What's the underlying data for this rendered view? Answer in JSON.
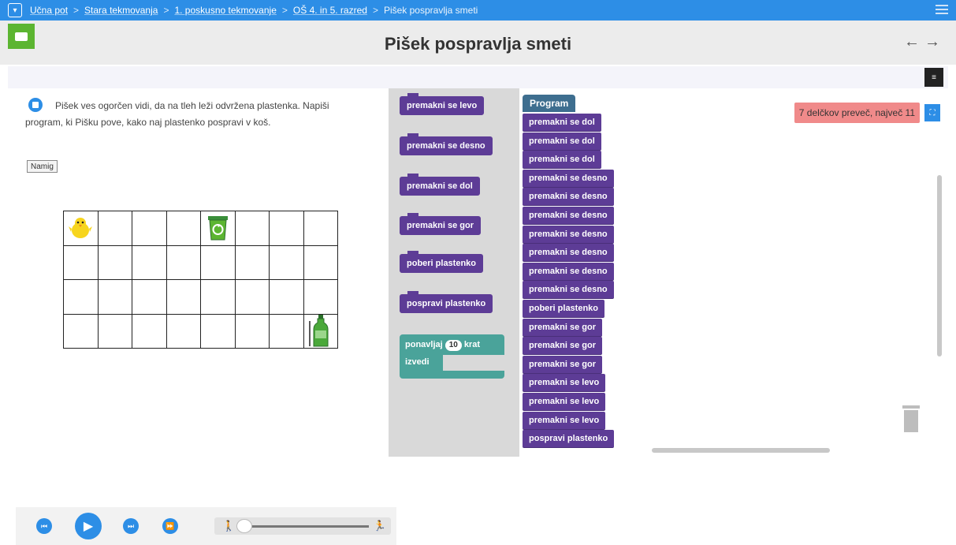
{
  "breadcrumb": {
    "items": [
      "Učna pot",
      "Stara tekmovanja",
      "1. poskusno tekmovanje",
      "OŠ 4. in 5. razred",
      "Pišek pospravlja smeti"
    ],
    "separator": ">"
  },
  "page": {
    "title": "Pišek pospravlja smeti"
  },
  "nav": {
    "back": "←",
    "forward": "→"
  },
  "task": {
    "text": "Pišek ves ogorčen vidi, da na tleh leži odvržena plastenka. Napiši program, ki Pišku pove, kako naj plastenko pospravi v koš.",
    "hint_label": "Namig"
  },
  "grid": {
    "rows": 4,
    "cols": 8
  },
  "toolbox": {
    "blocks": [
      "premakni se levo",
      "premakni se desno",
      "premakni se dol",
      "premakni se gor",
      "poberi plastenko",
      "pospravi plastenko"
    ],
    "loop": {
      "label_repeat": "ponavljaj",
      "count": "10",
      "label_times": "krat",
      "label_do": "izvedi"
    }
  },
  "workspace": {
    "program_label": "Program",
    "blocks": [
      "premakni se dol",
      "premakni se dol",
      "premakni se dol",
      "premakni se desno",
      "premakni se desno",
      "premakni se desno",
      "premakni se desno",
      "premakni se desno",
      "premakni se desno",
      "premakni se desno",
      "poberi plastenko",
      "premakni se gor",
      "premakni se gor",
      "premakni se gor",
      "premakni se levo",
      "premakni se levo",
      "premakni se levo",
      "pospravi plastenko"
    ],
    "counter": "7 delčkov preveč, največ 11"
  },
  "colors": {
    "accent": "#2d8ee6",
    "block": "#5d3c96",
    "loop": "#4aa39a",
    "program": "#3e6e8f",
    "counter_bg": "#f08a8a",
    "green": "#5cb531"
  }
}
